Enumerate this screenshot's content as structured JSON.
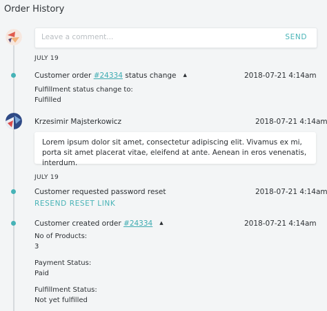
{
  "page": {
    "title": "Order History"
  },
  "comment_form": {
    "placeholder": "Leave a comment...",
    "send_label": "SEND"
  },
  "colors": {
    "accent": "#47b3b6",
    "timeline_dot": "#46b3b7",
    "line": "#d6dadd"
  },
  "events": [
    {
      "date": "JULY 19",
      "title_prefix": "Customer order ",
      "order_link": "#24334",
      "title_suffix": " status change",
      "caret": "▲",
      "timestamp": "2018-07-21 4:14am",
      "details": [
        {
          "label": "Fulfillment status change to:",
          "value": "Fulfilled"
        }
      ]
    },
    {
      "author": "Krzesimir Majsterkowicz",
      "timestamp": "2018-07-21 4:14am",
      "comment": "Lorem ipsum dolor sit amet, consectetur adipiscing elit. Vivamus ex mi, porta sit amet placerat vitae, eleifend at ante. Aenean in eros venenatis, interdum."
    },
    {
      "date": "JULY 19",
      "title": "Customer requested password reset",
      "timestamp": "2018-07-21 4:14am",
      "action_label": "RESEND RESET LINK"
    },
    {
      "title_prefix": "Customer created order ",
      "order_link": "#24334",
      "caret": "▲",
      "timestamp": "2018-07-21 4:14am",
      "details": [
        {
          "label": "No of Products:",
          "value": "3"
        },
        {
          "label": "Payment Status:",
          "value": "Paid"
        },
        {
          "label": "Fulfillment Status:",
          "value": "Not yet fulfilled"
        }
      ]
    }
  ]
}
